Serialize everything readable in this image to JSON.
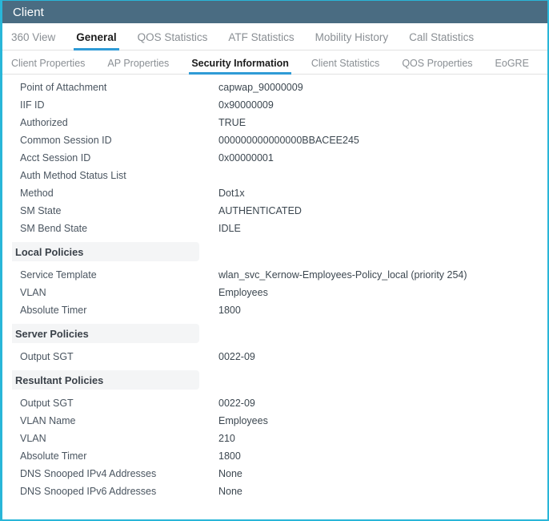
{
  "window": {
    "title": "Client"
  },
  "colors": {
    "titlebar_bg": "#4a6c82",
    "accent_border": "#29b6d8",
    "active_tab_underline": "#2f9bd6",
    "section_header_bg": "#f4f5f6"
  },
  "primary_tabs": [
    {
      "label": "360 View",
      "active": false
    },
    {
      "label": "General",
      "active": true
    },
    {
      "label": "QOS Statistics",
      "active": false
    },
    {
      "label": "ATF Statistics",
      "active": false
    },
    {
      "label": "Mobility History",
      "active": false
    },
    {
      "label": "Call Statistics",
      "active": false
    }
  ],
  "secondary_tabs": [
    {
      "label": "Client Properties",
      "active": false
    },
    {
      "label": "AP Properties",
      "active": false
    },
    {
      "label": "Security Information",
      "active": true
    },
    {
      "label": "Client Statistics",
      "active": false
    },
    {
      "label": "QOS Properties",
      "active": false
    },
    {
      "label": "EoGRE",
      "active": false
    }
  ],
  "security_information": {
    "top_fields": [
      {
        "label": "Point of Attachment",
        "value": "capwap_90000009"
      },
      {
        "label": "IIF ID",
        "value": "0x90000009"
      },
      {
        "label": "Authorized",
        "value": "TRUE"
      },
      {
        "label": "Common Session ID",
        "value": "000000000000000BBACEE245"
      },
      {
        "label": "Acct Session ID",
        "value": "0x00000001"
      },
      {
        "label": "Auth Method Status List",
        "value": ""
      },
      {
        "label": "Method",
        "value": "Dot1x"
      },
      {
        "label": "SM State",
        "value": "AUTHENTICATED"
      },
      {
        "label": "SM Bend State",
        "value": "IDLE"
      }
    ],
    "sections": [
      {
        "header": "Local Policies",
        "fields": [
          {
            "label": "Service Template",
            "value": "wlan_svc_Kernow-Employees-Policy_local (priority 254)"
          },
          {
            "label": "VLAN",
            "value": "Employees"
          },
          {
            "label": "Absolute Timer",
            "value": "1800"
          }
        ]
      },
      {
        "header": "Server Policies",
        "fields": [
          {
            "label": "Output SGT",
            "value": "0022-09"
          }
        ]
      },
      {
        "header": "Resultant Policies",
        "fields": [
          {
            "label": "Output SGT",
            "value": "0022-09"
          },
          {
            "label": "VLAN Name",
            "value": "Employees"
          },
          {
            "label": "VLAN",
            "value": "210"
          },
          {
            "label": "Absolute Timer",
            "value": "1800"
          },
          {
            "label": "DNS Snooped IPv4 Addresses",
            "value": "None"
          },
          {
            "label": "DNS Snooped IPv6 Addresses",
            "value": "None"
          }
        ]
      }
    ]
  }
}
